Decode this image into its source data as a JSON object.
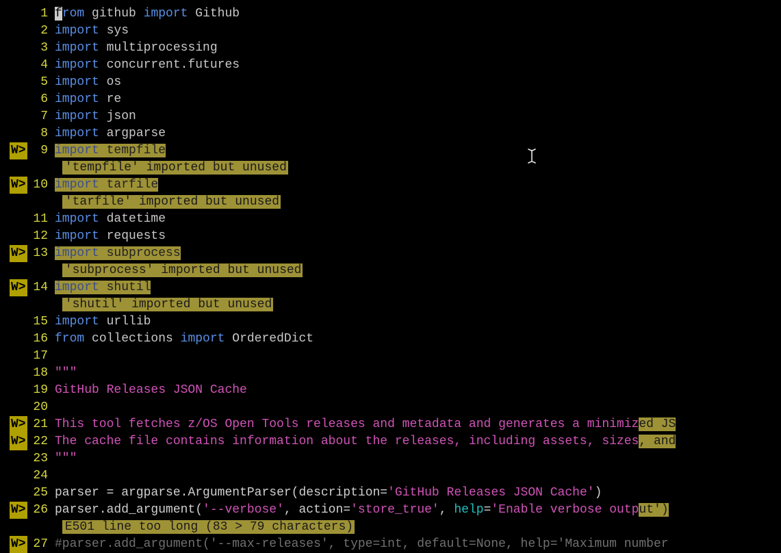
{
  "warn_marker": "W>",
  "cursor_char": "f",
  "lines": [
    {
      "n": 1,
      "segments": [
        {
          "t": "rom ",
          "c": "kw"
        },
        {
          "t": "github ",
          "c": "mod"
        },
        {
          "t": "import ",
          "c": "kw"
        },
        {
          "t": "Github",
          "c": "cls"
        }
      ]
    },
    {
      "n": 2,
      "segments": [
        {
          "t": "import ",
          "c": "kw"
        },
        {
          "t": "sys",
          "c": "mod"
        }
      ]
    },
    {
      "n": 3,
      "segments": [
        {
          "t": "import ",
          "c": "kw"
        },
        {
          "t": "multiprocessing",
          "c": "mod"
        }
      ]
    },
    {
      "n": 4,
      "segments": [
        {
          "t": "import ",
          "c": "kw"
        },
        {
          "t": "concurrent.futures",
          "c": "mod"
        }
      ]
    },
    {
      "n": 5,
      "segments": [
        {
          "t": "import ",
          "c": "kw"
        },
        {
          "t": "os",
          "c": "mod"
        }
      ]
    },
    {
      "n": 6,
      "segments": [
        {
          "t": "import ",
          "c": "kw"
        },
        {
          "t": "re",
          "c": "mod"
        }
      ]
    },
    {
      "n": 7,
      "segments": [
        {
          "t": "import ",
          "c": "kw"
        },
        {
          "t": "json",
          "c": "mod"
        }
      ]
    },
    {
      "n": 8,
      "segments": [
        {
          "t": "import ",
          "c": "kw"
        },
        {
          "t": "argparse",
          "c": "mod"
        }
      ]
    },
    {
      "n": 9,
      "warn": true,
      "hl": true,
      "segments": [
        {
          "t": "import ",
          "c": "kw"
        },
        {
          "t": "tempfile",
          "c": "mod"
        }
      ],
      "diag": "'tempfile' imported but unused"
    },
    {
      "n": 10,
      "warn": true,
      "hl": true,
      "segments": [
        {
          "t": "import ",
          "c": "kw"
        },
        {
          "t": "tarfile",
          "c": "mod"
        }
      ],
      "diag": "'tarfile' imported but unused"
    },
    {
      "n": 11,
      "segments": [
        {
          "t": "import ",
          "c": "kw"
        },
        {
          "t": "datetime",
          "c": "mod"
        }
      ]
    },
    {
      "n": 12,
      "segments": [
        {
          "t": "import ",
          "c": "kw"
        },
        {
          "t": "requests",
          "c": "mod"
        }
      ]
    },
    {
      "n": 13,
      "warn": true,
      "hl": true,
      "segments": [
        {
          "t": "import ",
          "c": "kw"
        },
        {
          "t": "subprocess",
          "c": "mod"
        }
      ],
      "diag": "'subprocess' imported but unused"
    },
    {
      "n": 14,
      "warn": true,
      "hl": true,
      "segments": [
        {
          "t": "import ",
          "c": "kw"
        },
        {
          "t": "shutil",
          "c": "mod"
        }
      ],
      "diag": "'shutil' imported but unused"
    },
    {
      "n": 15,
      "segments": [
        {
          "t": "import ",
          "c": "kw"
        },
        {
          "t": "urllib",
          "c": "mod"
        }
      ]
    },
    {
      "n": 16,
      "segments": [
        {
          "t": "from ",
          "c": "kw"
        },
        {
          "t": "collections ",
          "c": "mod"
        },
        {
          "t": "import ",
          "c": "kw"
        },
        {
          "t": "OrderedDict",
          "c": "cls"
        }
      ]
    },
    {
      "n": 17,
      "segments": [
        {
          "t": "",
          "c": "op"
        }
      ]
    },
    {
      "n": 18,
      "segments": [
        {
          "t": "\"\"\"",
          "c": "str"
        }
      ]
    },
    {
      "n": 19,
      "segments": [
        {
          "t": "GitHub Releases JSON Cache",
          "c": "str"
        }
      ]
    },
    {
      "n": 20,
      "segments": [
        {
          "t": "",
          "c": "str"
        }
      ]
    },
    {
      "n": 21,
      "warn": true,
      "docline": true,
      "text": "This tool fetches z/OS Open Tools releases and metadata and generates a minimiz",
      "tail": "ed JS"
    },
    {
      "n": 22,
      "warn": true,
      "docline": true,
      "text": "The cache file contains information about the releases, including assets, sizes",
      "tail": ", and"
    },
    {
      "n": 23,
      "segments": [
        {
          "t": "\"\"\"",
          "c": "str"
        }
      ]
    },
    {
      "n": 24,
      "segments": [
        {
          "t": "",
          "c": "op"
        }
      ]
    },
    {
      "n": 25,
      "segments": [
        {
          "t": "parser ",
          "c": "op"
        },
        {
          "t": "= ",
          "c": "op"
        },
        {
          "t": "argparse.ArgumentParser(description",
          "c": "op"
        },
        {
          "t": "=",
          "c": "op"
        },
        {
          "t": "'GitHub Releases JSON Cache'",
          "c": "sq"
        },
        {
          "t": ")",
          "c": "op"
        }
      ]
    },
    {
      "n": 26,
      "warn": true,
      "segments": [
        {
          "t": "parser.add_argument(",
          "c": "op"
        },
        {
          "t": "'--verbose'",
          "c": "sq"
        },
        {
          "t": ", action",
          "c": "op"
        },
        {
          "t": "=",
          "c": "op"
        },
        {
          "t": "'store_true'",
          "c": "sq"
        },
        {
          "t": ", ",
          "c": "op"
        },
        {
          "t": "help",
          "c": "arg"
        },
        {
          "t": "=",
          "c": "op"
        },
        {
          "t": "'Enable verbose outp",
          "c": "sq"
        }
      ],
      "tailseg": [
        {
          "t": "ut'",
          "c": "sq",
          "hl": true
        },
        {
          "t": ")",
          "c": "op",
          "hl": true
        }
      ],
      "diag": "E501 line too long (83 > 79 characters)"
    },
    {
      "n": 27,
      "warn": true,
      "segments": [
        {
          "t": "#parser.add_argument('--max-releases', type=int, default=None, help='Maximum number ",
          "c": "cmt"
        }
      ]
    }
  ]
}
